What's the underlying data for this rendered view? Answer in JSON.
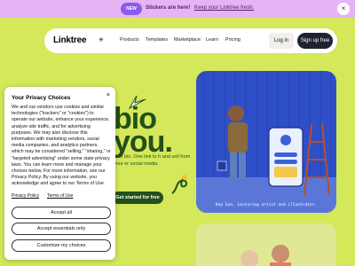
{
  "banner": {
    "badge": "NEW",
    "lead": "Stickers are here!",
    "link": "Keep your Linktree fresh.",
    "close_icon": "×"
  },
  "nav": {
    "logo": "Linktree",
    "logo_mark": "✳",
    "links": [
      "Products",
      "Templates",
      "Marketplace",
      "Learn",
      "Pricing"
    ],
    "login": "Log in",
    "signup": "Sign up free"
  },
  "hero": {
    "line1": "bio",
    "line2": "you.",
    "body": "rs in bio. One link to h and sell from your er social media.",
    "cta": "Get started for free"
  },
  "photo": {
    "caption": "Kay Sun, Lecturing artist and illustrator."
  },
  "cookie": {
    "title": "Your Privacy Choices",
    "close_icon": "×",
    "text": "We and our vendors use cookies and similar technologies (\"trackers\" or \"cookies\") to operate our website, enhance your experience, analyze site traffic, and for advertising purposes. We may also disclose this information with marketing vendors, social media companies, and analytics partners, which may be considered \"selling,\" \"sharing,\" or \"targeted advertising\" under some state privacy laws. You can learn more and manage your choices below. For more information, see our Privacy Policy. By using our website, you acknowledge and agree to our Terms of Use.",
    "privacy_link": "Privacy Policy",
    "terms_link": "Terms of Use",
    "accept_all": "Accept all",
    "accept_essential": "Accept essentials only",
    "customize": "Customize my choices"
  }
}
